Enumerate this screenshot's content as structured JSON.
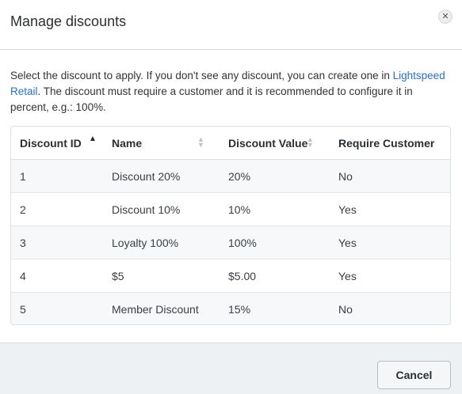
{
  "modal": {
    "title": "Manage discounts",
    "close_icon": "close-icon",
    "close_glyph": "✕"
  },
  "description": {
    "text_before": "Select the discount to apply. If you don't see any discount, you can create one in ",
    "link_text": "Lightspeed Retail",
    "text_after": ". The discount must require a customer and it is recommended to configure it in percent, e.g.: 100%."
  },
  "table": {
    "columns": [
      {
        "label": "Discount ID",
        "sort": "ascending"
      },
      {
        "label": "Name",
        "sort": "sortable"
      },
      {
        "label": "Discount Value",
        "sort": "sortable"
      },
      {
        "label": "Require Customer",
        "sort": "none"
      }
    ],
    "rows": [
      {
        "id": "1",
        "name": "Discount 20%",
        "value": "20%",
        "require": "No"
      },
      {
        "id": "2",
        "name": "Discount 10%",
        "value": "10%",
        "require": "Yes"
      },
      {
        "id": "3",
        "name": "Loyalty 100%",
        "value": "100%",
        "require": "Yes"
      },
      {
        "id": "4",
        "name": "$5",
        "value": "$5.00",
        "require": "Yes"
      },
      {
        "id": "5",
        "name": "Member Discount",
        "value": "15%",
        "require": "No"
      }
    ]
  },
  "footer": {
    "cancel_label": "Cancel"
  },
  "colors": {
    "link": "#2a6fc9",
    "footer_bg": "#eef1f4",
    "row_stripe": "#f7f8f9"
  }
}
